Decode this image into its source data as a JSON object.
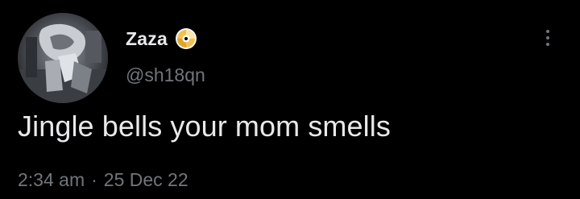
{
  "tweet": {
    "display_name": "Zaza",
    "handle": "@sh18qn",
    "text": "Jingle bells your mom smells",
    "time": "2:34 am",
    "separator": "·",
    "date": "25 Dec 22"
  },
  "icons": {
    "badge": "cd-disc-icon",
    "more": "more-vertical-icon"
  },
  "colors": {
    "background": "#000000",
    "primary_text": "#e7e9ea",
    "secondary_text": "#71767b",
    "badge_gold": "#f2c14e"
  }
}
